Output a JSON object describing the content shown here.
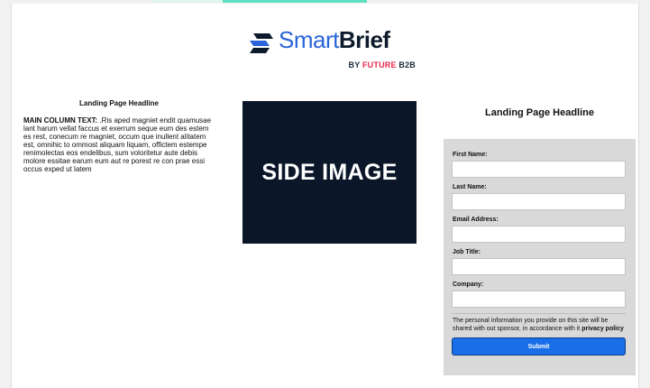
{
  "brand": {
    "name_light": "Smart",
    "name_bold": "Brief",
    "tag_by": "BY",
    "tag_future": "FUTURE",
    "tag_b2b": "B2B",
    "colors": {
      "smart": "#2a64d8",
      "brief": "#0d1a2b",
      "future": "#e8294b",
      "accent": "#5fe0c2"
    }
  },
  "left": {
    "headline": "Landing Page Headline",
    "body_lead": "MAIN COLUMN TEXT:",
    "body_text": " .Ris aped magniet endit quamusae lant harum vellat faccus et exerrum seque eum des estem es rest, conecum re magniet, occum que inullent alitatem est, omnihic to ommost aliquam liquam, offictem estempe renimolectas eos endelibus, sum voloritetur aute debis molore essitae earum eum aut re porest re con prae essi occus exped ut latem"
  },
  "side_image": {
    "label": "SIDE IMAGE",
    "background": "#0b1729"
  },
  "right": {
    "headline": "Landing Page Headline"
  },
  "form": {
    "fields": [
      {
        "label": "First Name:",
        "value": ""
      },
      {
        "label": "Last Name:",
        "value": ""
      },
      {
        "label": "Email Address:",
        "value": ""
      },
      {
        "label": "Job Title:",
        "value": ""
      },
      {
        "label": "Company:",
        "value": ""
      }
    ],
    "disclaimer_text": "The personal information you provide on this site will be shared with out sponsor, in accordance with it ",
    "disclaimer_link": "privacy policy",
    "submit_label": "Submit",
    "submit_color": "#1a6ee8"
  }
}
